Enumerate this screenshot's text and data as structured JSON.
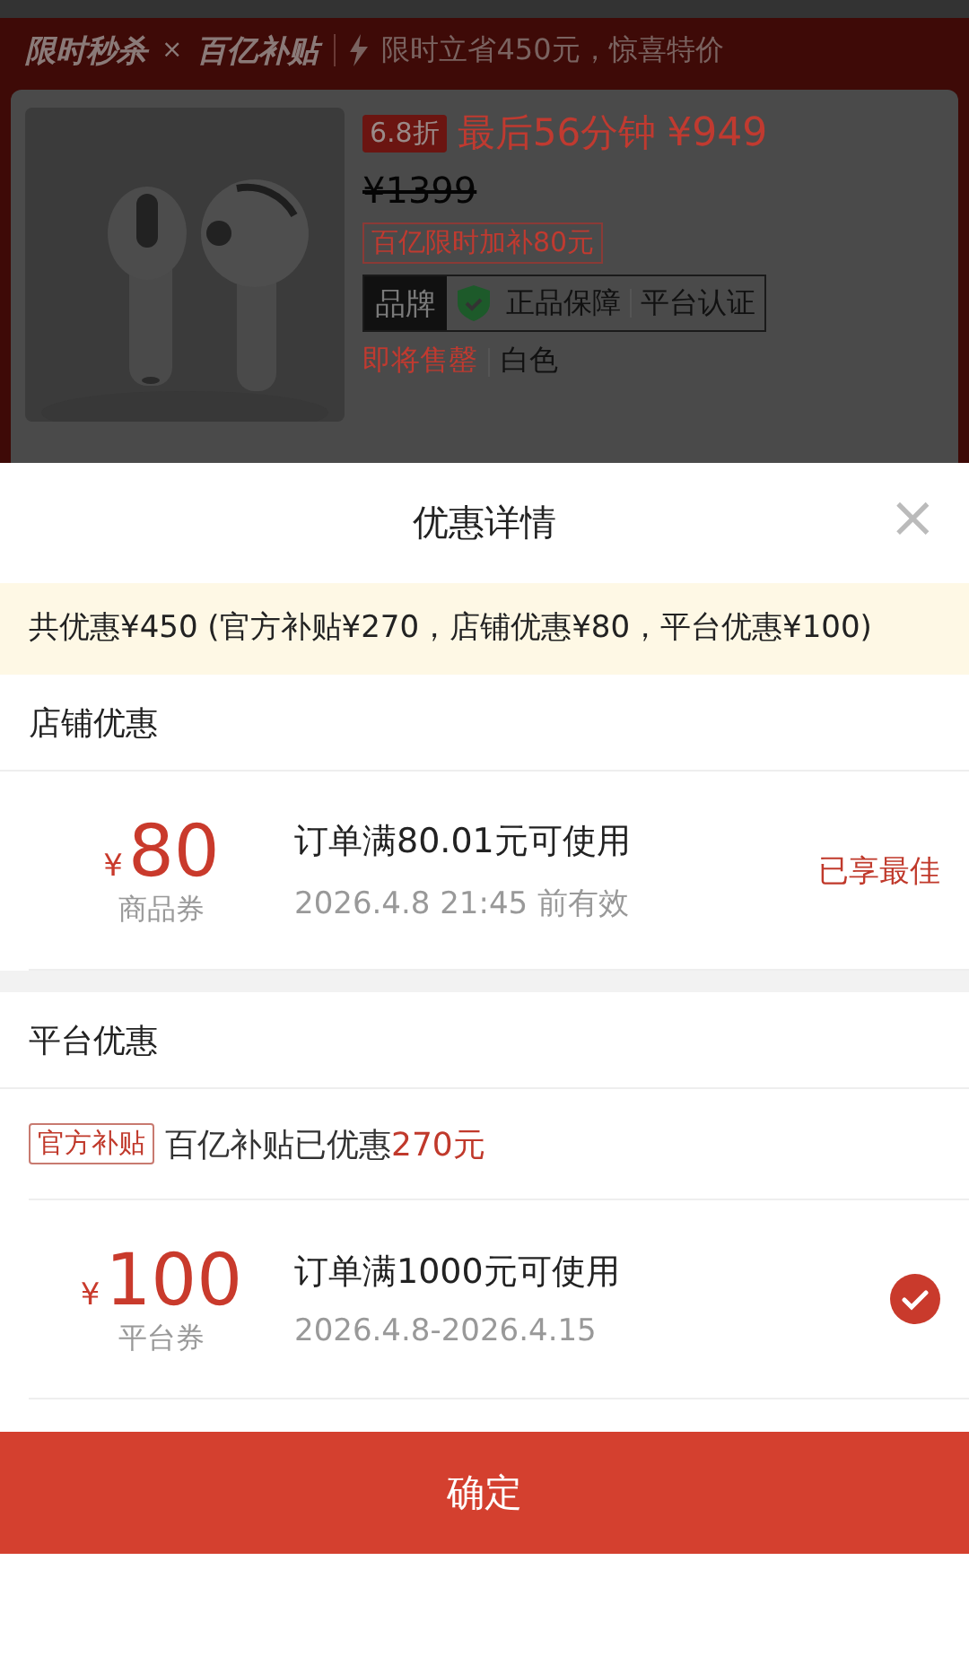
{
  "banner": {
    "logo_left": "限时秒杀",
    "logo_times": "×",
    "logo_right": "百亿补贴",
    "tagline": "限时立省450元，惊喜特价"
  },
  "product": {
    "discount": "6.8折",
    "countdown": "最后56分钟",
    "price": "¥949",
    "original_price": "¥1399",
    "extra_subsidy": "百亿限时加补80元",
    "brand_label": "品牌",
    "guarantees": [
      "正品保障",
      "平台认证"
    ],
    "stock": "即将售罄",
    "variant": "白色"
  },
  "sheet": {
    "title": "优惠详情",
    "close": "×",
    "summary": "共优惠¥450 (官方补贴¥270，店铺优惠¥80，平台优惠¥100)",
    "sections": [
      {
        "title": "店铺优惠",
        "coupons": [
          {
            "currency": "¥",
            "amount": "80",
            "type": "商品券",
            "condition": "订单满80.01元可使用",
            "validity": "2026.4.8 21:45 前有效",
            "status": "已享最佳",
            "checked": false
          }
        ]
      },
      {
        "title": "平台优惠",
        "subsidy": {
          "tag": "官方补贴",
          "text": "百亿补贴已优惠",
          "amount": "270元"
        },
        "coupons": [
          {
            "currency": "¥",
            "amount": "100",
            "type": "平台券",
            "condition": "订单满1000元可使用",
            "validity": "2026.4.8-2026.4.15",
            "checked": true
          }
        ]
      }
    ],
    "confirm": "确定"
  }
}
